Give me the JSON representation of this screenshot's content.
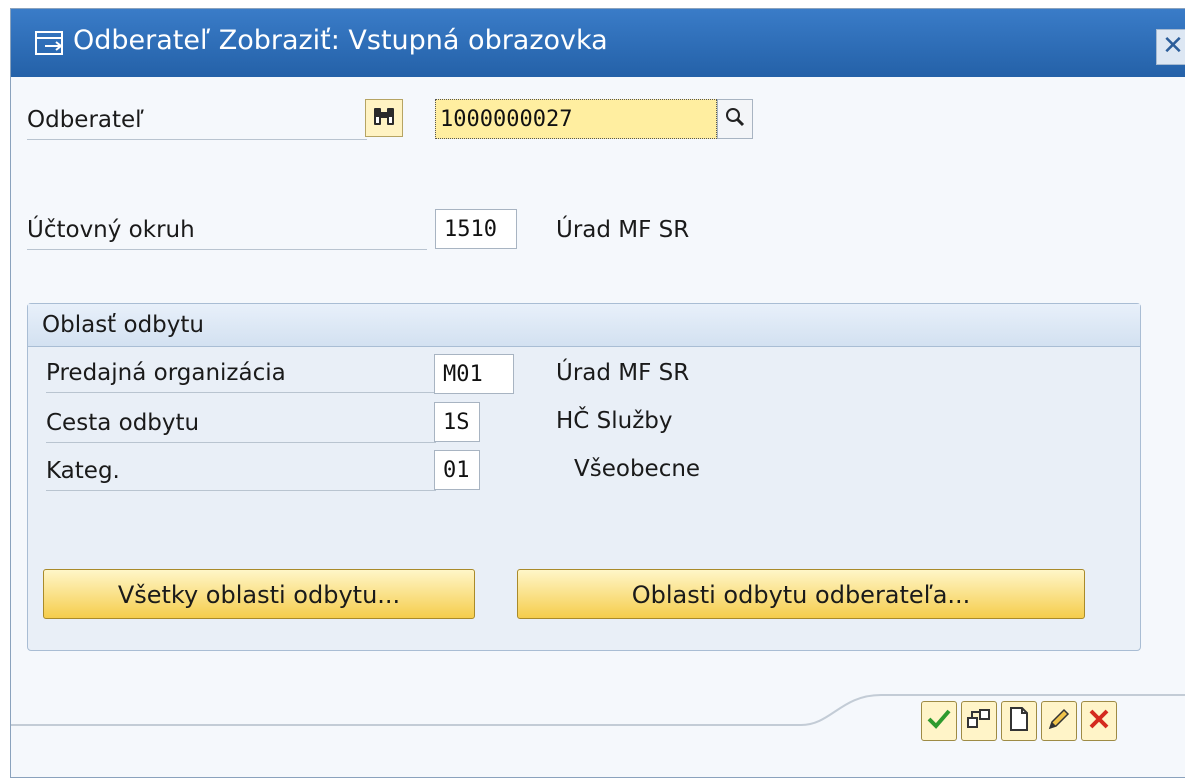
{
  "window": {
    "title": "Odberateľ Zobraziť: Vstupná obrazovka",
    "title_icon": "screen-arrow-icon",
    "close_icon": "close-icon"
  },
  "customer": {
    "label": "Odberateľ",
    "value": "1000000027",
    "search_icon": "binoculars-icon",
    "help_icon": "magnifier-icon"
  },
  "company_code": {
    "label": "Účtovný okruh",
    "value": "1510",
    "description": "Úrad MF SR"
  },
  "sales_area": {
    "header": "Oblasť odbytu",
    "sales_org": {
      "label": "Predajná organizácia",
      "value": "M01",
      "description": "Úrad MF SR"
    },
    "distribution_channel": {
      "label": "Cesta odbytu",
      "value": "1S",
      "description": "HČ Služby"
    },
    "division": {
      "label": "Kateg.",
      "value": "01",
      "description": "Všeobecne"
    },
    "all_sales_areas_button": "Všetky oblasti odbytu...",
    "customer_sales_areas_button": "Oblasti odbytu odberateľa..."
  },
  "toolbar": {
    "icons": [
      "check-icon",
      "hierarchy-icon",
      "new-document-icon",
      "pencil-icon",
      "cancel-icon"
    ],
    "colors": {
      "check": "#2e9a2e",
      "cancel": "#d42a1f"
    }
  }
}
